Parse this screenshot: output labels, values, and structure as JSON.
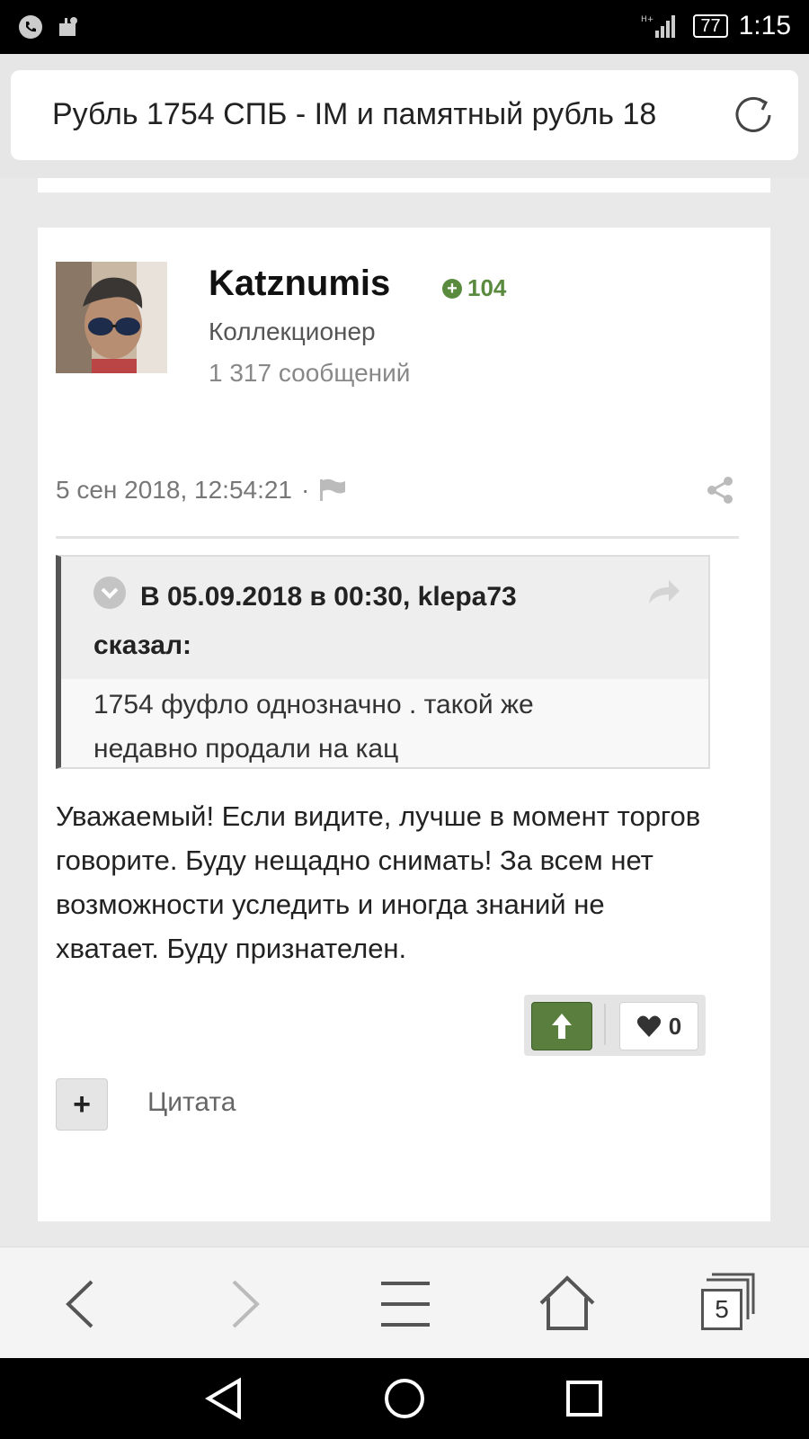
{
  "status": {
    "battery": "77",
    "time": "1:15"
  },
  "browser": {
    "page_title": "Рубль 1754 СПБ - IМ и памятный рубль 18",
    "tabs_count": "5"
  },
  "post": {
    "author": "Katznumis",
    "reputation": "104",
    "rank": "Коллекционер",
    "post_count": "1 317 сообщений",
    "timestamp": "5 сен 2018, 12:54:21",
    "meta_separator": "·",
    "quote": {
      "citation": "В 05.09.2018 в 00:30, klepa73 сказал:",
      "text": "1754 фуфло однозначно . такой же недавно продали на кац"
    },
    "body": "Уважаемый! Если видите, лучше в момент торгов говорите. Буду нещадно снимать! За всем нет возможности уследить и иногда знаний не хватает. Буду признателен.",
    "likes": "0",
    "quote_button_label": "Цитата",
    "add_button_label": "+"
  },
  "colors": {
    "accent_green": "#5a7e3e",
    "reputation_green": "#5a8a3d"
  }
}
